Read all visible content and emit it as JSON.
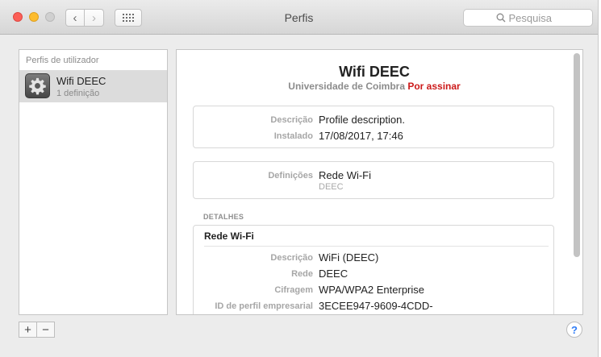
{
  "window": {
    "title": "Perfis"
  },
  "toolbar": {
    "back_label": "‹",
    "forward_label": "›",
    "grid_icon": "grid-icon"
  },
  "search": {
    "placeholder": "Pesquisa"
  },
  "sidebar": {
    "header": "Perfis de utilizador",
    "items": [
      {
        "name": "Wifi DEEC",
        "subtitle": "1 definição",
        "icon": "profile-gear-icon"
      }
    ]
  },
  "footer": {
    "add_label": "+",
    "remove_label": "−",
    "help_label": "?"
  },
  "detail": {
    "title": "Wifi DEEC",
    "organization": "Universidade de Coimbra",
    "status": "Por assinar",
    "info": {
      "description_label": "Descrição",
      "description_value": "Profile description.",
      "installed_label": "Instalado",
      "installed_value": "17/08/2017, 17:46"
    },
    "settings": {
      "label": "Definições",
      "value": "Rede Wi-Fi",
      "sub": "DEEC"
    },
    "details_header": "DETALHES",
    "wifi": {
      "title": "Rede Wi-Fi",
      "description_label": "Descrição",
      "description_value": "WiFi (DEEC)",
      "network_label": "Rede",
      "network_value": "DEEC",
      "encryption_label": "Cifragem",
      "encryption_value": "WPA/WPA2 Enterprise",
      "enterprise_id_label": "ID de perfil empresarial",
      "enterprise_id_value": "3ECEE947-9609-4CDD-"
    }
  }
}
